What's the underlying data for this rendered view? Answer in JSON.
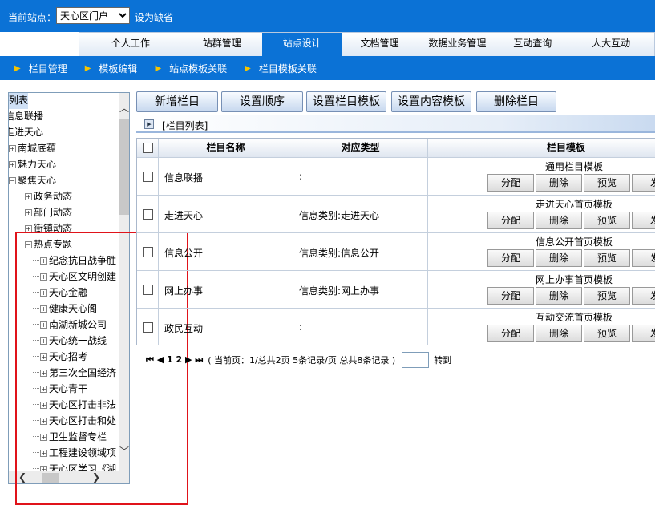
{
  "topbar": {
    "label": "当前站点：",
    "site_value": "天心区门户",
    "set_default": "设为缺省"
  },
  "nav": {
    "tabs": [
      "个人工作",
      "站群管理",
      "站点设计",
      "文档管理",
      "数据业务管理",
      "互动查询",
      "人大互动"
    ],
    "active_index": 2
  },
  "breadcrumb": [
    "栏目管理",
    "模板编辑",
    "站点模板关联",
    "栏目模板关联"
  ],
  "tree": {
    "nodes": [
      "列表",
      "信息联播",
      "走进天心",
      "南城底蕴",
      "魅力天心",
      "聚焦天心",
      "政务动态",
      "部门动态",
      "街镇动态",
      "热点专题",
      "纪念抗日战争胜",
      "天心区文明创建",
      "天心金融",
      "健康天心阁",
      "南湖新城公司",
      "天心统一战线",
      "天心招考",
      "第三次全国经济",
      "天心青干",
      "天心区打击非法",
      "天心区打击和处",
      "卫生监督专栏",
      "工程建设领域项",
      "天心区学习《湖"
    ]
  },
  "toolbar": {
    "buttons": [
      "新增栏目",
      "设置顺序",
      "设置栏目模板",
      "设置内容模板",
      "删除栏目"
    ]
  },
  "list": {
    "title": "[栏目列表]",
    "headers": {
      "name": "栏目名称",
      "type": "对应类型",
      "template": "栏目模板"
    },
    "actions": [
      "分配",
      "删除",
      "预览",
      "发"
    ],
    "rows": [
      {
        "name": "信息联播",
        "type": ":",
        "template": "通用栏目模板"
      },
      {
        "name": "走进天心",
        "type": "信息类别:走进天心",
        "template": "走进天心首页模板"
      },
      {
        "name": "信息公开",
        "type": "信息类别:信息公开",
        "template": "信息公开首页模板"
      },
      {
        "name": "网上办事",
        "type": "信息类别:网上办事",
        "template": "网上办事首页模板"
      },
      {
        "name": "政民互动",
        "type": ":",
        "template": "互动交流首页模板"
      }
    ]
  },
  "pager": {
    "nav": "⏮ ◀ 1 2 ▶ ⏭",
    "status": "( 当前页：1/总共2页 5条记录/页 总共8条记录 )",
    "goto": "转到"
  },
  "colors": {
    "header_blue": "#0b72d6",
    "arrow_yellow": "#f5c400",
    "highlight_red": "#e0131a"
  }
}
